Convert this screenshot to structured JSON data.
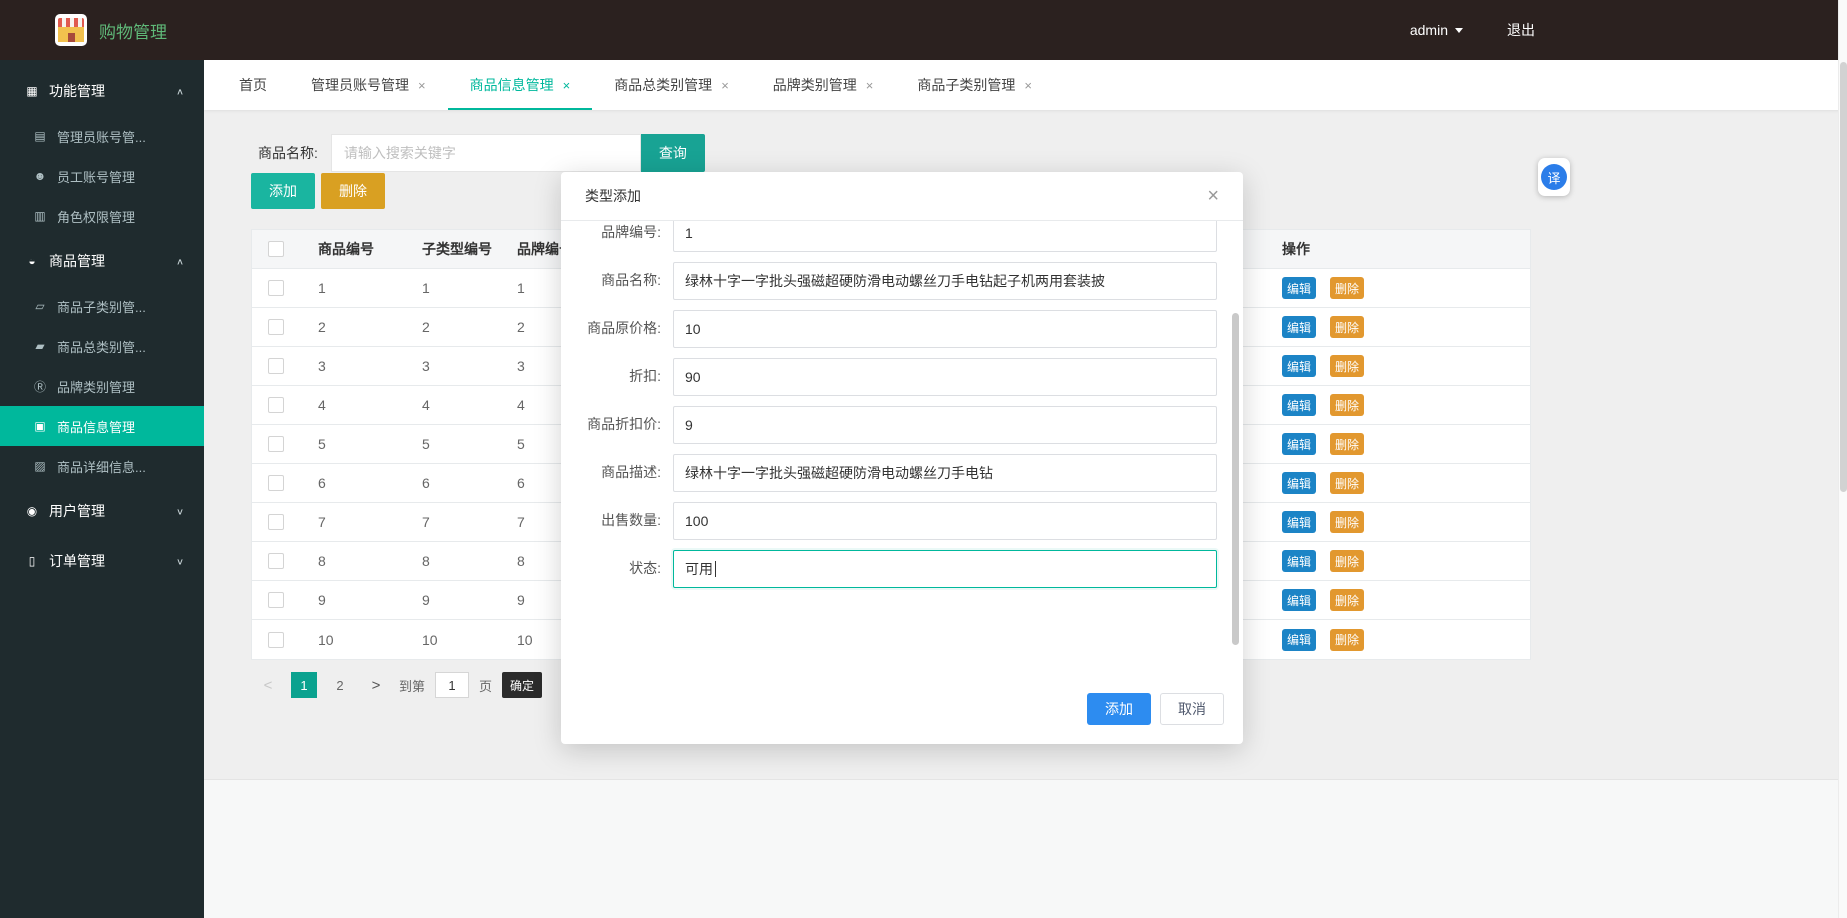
{
  "colors": {
    "accent_teal": "#00b89c",
    "header_bg": "#2b211f",
    "sidebar_bg": "#1f2b2e",
    "brand_green": "#5FB878",
    "primary_blue": "#2d8cf0",
    "query_teal": "#18a394",
    "add_teal": "#1ab5a0",
    "warning_amber": "#d9a022",
    "edit_blue": "#1c84c6",
    "row_delete_amber": "#e2982f",
    "pager_active": "#0aa28f",
    "confirm_dark": "#2b2b2b",
    "translate_blue": "#2b7de9"
  },
  "header": {
    "app_title": "购物管理",
    "user": "admin",
    "logout": "退出"
  },
  "sidebar": {
    "items": [
      {
        "label": "功能管理",
        "icon": "grid-icon",
        "type": "section",
        "chevron": "up"
      },
      {
        "label": "管理员账号管...",
        "icon": "accounts-icon",
        "type": "sub"
      },
      {
        "label": "员工账号管理",
        "icon": "staff-icon",
        "type": "sub"
      },
      {
        "label": "角色权限管理",
        "icon": "role-icon",
        "type": "sub"
      },
      {
        "label": "商品管理",
        "icon": "goods-icon",
        "type": "section",
        "chevron": "up"
      },
      {
        "label": "商品子类别管...",
        "icon": "subcategory-icon",
        "type": "sub"
      },
      {
        "label": "商品总类别管...",
        "icon": "category-icon",
        "type": "sub"
      },
      {
        "label": "品牌类别管理",
        "icon": "brand-icon",
        "type": "sub"
      },
      {
        "label": "商品信息管理",
        "icon": "product-info-icon",
        "type": "sub",
        "active": true
      },
      {
        "label": "商品详细信息...",
        "icon": "product-detail-icon",
        "type": "sub"
      },
      {
        "label": "用户管理",
        "icon": "user-icon",
        "type": "section",
        "chevron": "down"
      },
      {
        "label": "订单管理",
        "icon": "order-icon",
        "type": "section",
        "chevron": "down"
      }
    ]
  },
  "tabs": [
    {
      "label": "首页",
      "closable": false,
      "active": false
    },
    {
      "label": "管理员账号管理",
      "closable": true,
      "active": false
    },
    {
      "label": "商品信息管理",
      "closable": true,
      "active": true
    },
    {
      "label": "商品总类别管理",
      "closable": true,
      "active": false
    },
    {
      "label": "品牌类别管理",
      "closable": true,
      "active": false
    },
    {
      "label": "商品子类别管理",
      "closable": true,
      "active": false
    }
  ],
  "ui": {
    "tab_close": "×"
  },
  "toolbar": {
    "search_label": "商品名称:",
    "search_placeholder": "请输入搜索关键字",
    "query_button": "查询",
    "add_button": "添加",
    "delete_button": "删除"
  },
  "table": {
    "headers": [
      "商品编号",
      "子类型编号",
      "品牌编号"
    ],
    "action_header": "操作",
    "edit_label": "编辑",
    "delete_label": "删除",
    "rows": [
      [
        "1",
        "1",
        "1"
      ],
      [
        "2",
        "2",
        "2"
      ],
      [
        "3",
        "3",
        "3"
      ],
      [
        "4",
        "4",
        "4"
      ],
      [
        "5",
        "5",
        "5"
      ],
      [
        "6",
        "6",
        "6"
      ],
      [
        "7",
        "7",
        "7"
      ],
      [
        "8",
        "8",
        "8"
      ],
      [
        "9",
        "9",
        "9"
      ],
      [
        "10",
        "10",
        "10"
      ]
    ]
  },
  "pagination": {
    "prev": "<",
    "pages": [
      "1",
      "2"
    ],
    "active_page": "1",
    "next": ">",
    "goto_label": "到第",
    "goto_value": "1",
    "page_label": "页",
    "confirm_button": "确定"
  },
  "modal": {
    "title": "类型添加",
    "close": "×",
    "fields": [
      {
        "label": "品牌编号:",
        "value": "1",
        "cut": true
      },
      {
        "label": "商品名称:",
        "value": "绿林十字一字批头强磁超硬防滑电动螺丝刀手电钻起子机两用套装披"
      },
      {
        "label": "商品原价格:",
        "value": "10"
      },
      {
        "label": "折扣:",
        "value": "90"
      },
      {
        "label": "商品折扣价:",
        "value": "9"
      },
      {
        "label": "商品描述:",
        "value": "绿林十字一字批头强磁超硬防滑电动螺丝刀手电钻"
      },
      {
        "label": "出售数量:",
        "value": "100"
      },
      {
        "label": "状态:",
        "value": "可用",
        "focused": true
      }
    ],
    "add_button": "添加",
    "cancel_button": "取消"
  },
  "floating": {
    "translate_icon": "译"
  }
}
